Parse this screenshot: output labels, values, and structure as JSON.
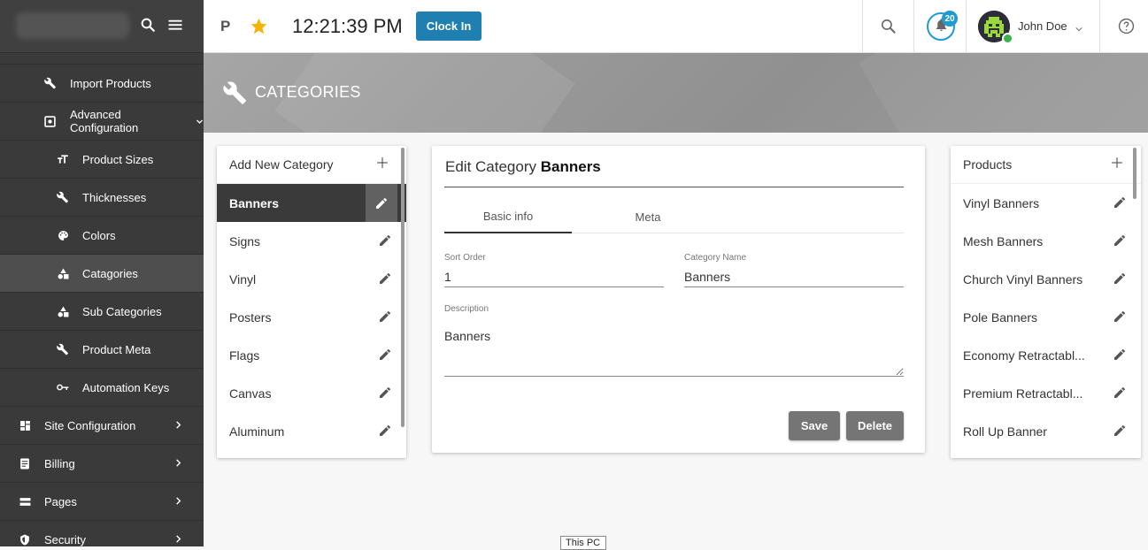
{
  "sidebar": {
    "items": [
      {
        "label": "Import Products",
        "icon": "wrench-icon"
      },
      {
        "label": "Advanced Configuration",
        "icon": "config-icon"
      },
      {
        "label": "Product Sizes",
        "icon": "text-size-icon"
      },
      {
        "label": "Thicknesses",
        "icon": "wrench-icon"
      },
      {
        "label": "Colors",
        "icon": "palette-icon"
      },
      {
        "label": "Catagories",
        "icon": "shapes-icon"
      },
      {
        "label": "Sub Categories",
        "icon": "shapes-icon"
      },
      {
        "label": "Product Meta",
        "icon": "wrench-icon"
      },
      {
        "label": "Automation Keys",
        "icon": "key-icon"
      },
      {
        "label": "Site Configuration",
        "icon": "dashboard-icon"
      },
      {
        "label": "Billing",
        "icon": "receipt-icon"
      },
      {
        "label": "Pages",
        "icon": "list-icon"
      },
      {
        "label": "Security",
        "icon": "shield-icon"
      }
    ],
    "active_index": 5
  },
  "topbar": {
    "p_label": "P",
    "time": "12:21:39 PM",
    "clock_in_label": "Clock In",
    "notification_count": "20",
    "user_name": "John Doe"
  },
  "banner": {
    "title": "CATEGORIES"
  },
  "categories": {
    "header": "Add New Category",
    "items": [
      "Banners",
      "Signs",
      "Vinyl",
      "Posters",
      "Flags",
      "Canvas",
      "Aluminum"
    ],
    "selected_index": 0
  },
  "edit": {
    "title_prefix": "Edit Category",
    "title_name": "Banners",
    "tabs": [
      "Basic info",
      "Meta"
    ],
    "active_tab": 0,
    "sort_order_label": "Sort Order",
    "sort_order_value": "1",
    "category_name_label": "Category Name",
    "category_name_value": "Banners",
    "description_label": "Description",
    "description_value": "Banners",
    "save_label": "Save",
    "delete_label": "Delete"
  },
  "products": {
    "header": "Products",
    "items": [
      "Vinyl Banners",
      "Mesh Banners",
      "Church Vinyl Banners",
      "Pole Banners",
      "Economy Retractabl...",
      "Premium Retractabl...",
      "Roll Up Banner"
    ]
  },
  "tooltip": {
    "text": "This PC"
  },
  "colors": {
    "sidebar": "#3a3a3a",
    "accent": "#1f7fb0",
    "star": "#f5b400",
    "notification": "#1f9bd1",
    "online": "#3cb34a"
  }
}
